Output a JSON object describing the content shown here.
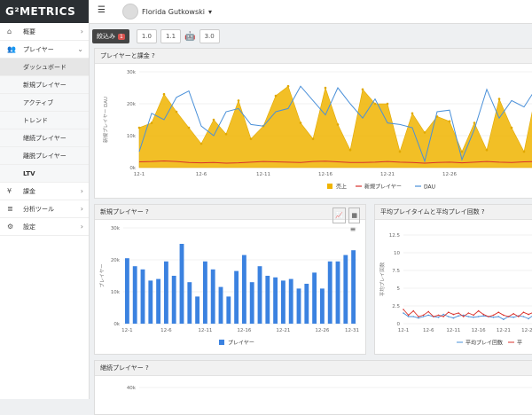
{
  "brand": {
    "logo": "G²METRICS"
  },
  "sidebar": {
    "items": [
      {
        "label": "概要"
      },
      {
        "label": "プレイヤー"
      },
      {
        "label": "ダッシュボード"
      },
      {
        "label": "新規プレイヤー"
      },
      {
        "label": "アクティブ"
      },
      {
        "label": "トレンド"
      },
      {
        "label": "継続プレイヤー"
      },
      {
        "label": "離脱プレイヤー"
      },
      {
        "label": "LTV"
      },
      {
        "label": "課金"
      },
      {
        "label": "分析ツール"
      },
      {
        "label": "設定"
      }
    ]
  },
  "header": {
    "user_name": "Florida Gutkowski"
  },
  "filter": {
    "label": "絞込み",
    "count": "1",
    "ios_versions": [
      "1.0",
      "1.1"
    ],
    "android_versions": [
      "3.0"
    ]
  },
  "panels": {
    "revenue_title": "プレイヤーと課金",
    "new_players_title": "新規プレイヤー",
    "playtime_title": "平均プレイタイムと平均プレイ回数",
    "retained_title": "継続プレイヤー"
  },
  "colors": {
    "revenue": "#f0b400",
    "new": "#d9312b",
    "dau": "#4a90d9",
    "bar": "#3b82e0"
  },
  "chart_data": [
    {
      "type": "area",
      "title": "プレイヤーと課金",
      "ylabel": "新規プレイヤー DAU",
      "yticks": [
        "0k",
        "10k",
        "20k",
        "30k"
      ],
      "xticks": [
        "12-1",
        "12-6",
        "12-11",
        "12-16",
        "12-21",
        "12-26"
      ],
      "legend": [
        "売上",
        "新規プレイヤー",
        "DAU"
      ],
      "ylim": [
        0,
        30000
      ],
      "series": [
        {
          "name": "売上",
          "values": [
            12500,
            14000,
            23000,
            17500,
            12500,
            7500,
            15000,
            10500,
            21000,
            9000,
            13000,
            22500,
            25500,
            14000,
            9000,
            25000,
            13500,
            5500,
            24500,
            20000,
            20000,
            5000,
            17000,
            11000,
            16000,
            14500,
            5000,
            14000,
            5500,
            21500,
            12500,
            5000,
            24000
          ]
        },
        {
          "name": "新規プレイヤー",
          "values": [
            1800,
            1900,
            2100,
            1900,
            1600,
            1500,
            1600,
            1400,
            1500,
            1700,
            1900,
            1800,
            1700,
            1600,
            1900,
            2000,
            1800,
            1600,
            1600,
            1700,
            1900,
            1700,
            1600,
            1400,
            1600,
            1700,
            1500,
            1700,
            1900,
            1700,
            1600,
            1800,
            1900
          ]
        },
        {
          "name": "DAU",
          "values": [
            5000,
            17000,
            15000,
            22000,
            24000,
            13000,
            10000,
            17500,
            18500,
            13500,
            13000,
            17500,
            18500,
            25500,
            21000,
            16500,
            25000,
            20000,
            15500,
            21500,
            14000,
            13500,
            12500,
            2000,
            17500,
            18000,
            2500,
            12000,
            24500,
            15500,
            21000,
            19000,
            25000
          ]
        }
      ]
    },
    {
      "type": "bar",
      "title": "新規プレイヤー",
      "ylabel": "プレイヤー",
      "yticks": [
        "0k",
        "10k",
        "20k",
        "30k"
      ],
      "xticks": [
        "12-1",
        "12-6",
        "12-11",
        "12-16",
        "12-21",
        "12-26",
        "12-31"
      ],
      "legend": [
        "プレイヤー"
      ],
      "ylim": [
        0,
        30000
      ],
      "values": [
        20500,
        18000,
        17000,
        13500,
        14000,
        19500,
        15000,
        25000,
        13000,
        8500,
        19500,
        17000,
        11500,
        8500,
        16500,
        21500,
        13000,
        18000,
        15000,
        14500,
        13500,
        14000,
        11000,
        12500,
        16000,
        11000,
        19500,
        19500,
        21500,
        23000
      ]
    },
    {
      "type": "line",
      "title": "平均プレイタイムと平均プレイ回数",
      "ylabel": "平均プレイ回数",
      "yticks": [
        "0",
        "2.5",
        "5",
        "7.5",
        "10",
        "12.5"
      ],
      "xticks": [
        "12-1",
        "12-6",
        "12-11",
        "12-16",
        "12-21",
        "12-26"
      ],
      "legend": [
        "平均プレイ回数",
        "平"
      ],
      "ylim": [
        0,
        12.5
      ],
      "series": [
        {
          "name": "平均プレイ回数",
          "values": [
            1.5,
            1.0,
            1.0,
            0.8,
            1.0,
            1.2,
            1.0,
            0.9,
            1.3,
            1.0,
            0.8,
            1.1,
            1.2,
            1.0,
            0.9,
            1.0,
            1.1,
            1.0,
            0.9,
            1.0,
            0.6,
            1.0,
            0.9,
            1.1,
            1.0,
            0.7,
            1.2,
            6.5,
            1.2
          ]
        },
        {
          "name": "平",
          "values": [
            2.0,
            1.2,
            1.8,
            1.0,
            1.2,
            1.7,
            1.0,
            1.2,
            1.0,
            1.6,
            1.3,
            1.5,
            1.0,
            1.5,
            1.2,
            1.8,
            1.3,
            1.0,
            1.2,
            1.6,
            1.2,
            1.0,
            1.4,
            1.0,
            1.6,
            1.3,
            1.6,
            10.5,
            1.5
          ]
        }
      ]
    },
    {
      "type": "line",
      "title": "継続プレイヤー",
      "yticks": [
        "40k"
      ],
      "ylim": [
        0,
        40000
      ]
    }
  ]
}
